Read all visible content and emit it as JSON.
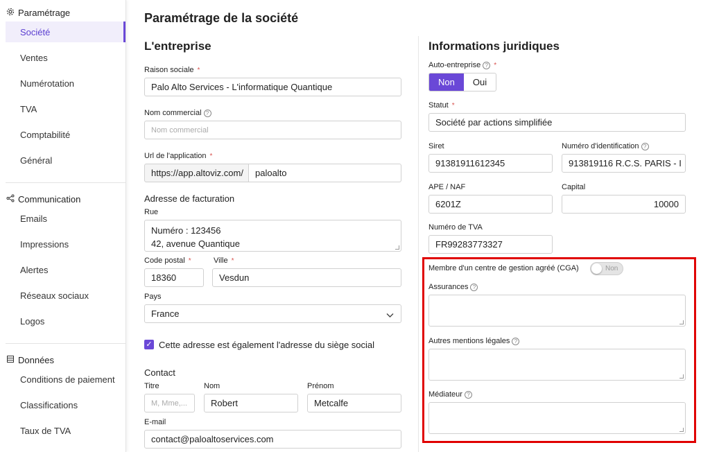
{
  "sidebar": {
    "sections": [
      {
        "title": "Paramétrage",
        "icon": "gear-icon"
      },
      {
        "title": "Communication",
        "icon": "share-icon"
      },
      {
        "title": "Données",
        "icon": "database-icon"
      }
    ],
    "parametrage_items": [
      "Société",
      "Ventes",
      "Numérotation",
      "TVA",
      "Comptabilité",
      "Général"
    ],
    "communication_items": [
      "Emails",
      "Impressions",
      "Alertes",
      "Réseaux sociaux",
      "Logos"
    ],
    "donnees_items": [
      "Conditions de paiement",
      "Classifications",
      "Taux de TVA"
    ],
    "active_color": "#6a48d7"
  },
  "page": {
    "title": "Paramétrage de la société"
  },
  "entreprise": {
    "heading": "L'entreprise",
    "raison_sociale_label": "Raison sociale",
    "raison_sociale_value": "Palo Alto Services - L'informatique Quantique",
    "nom_commercial_label": "Nom commercial",
    "nom_commercial_placeholder": "Nom commercial",
    "url_label": "Url de l'application",
    "url_prefix": "https://app.altoviz.com/",
    "url_value": "paloalto",
    "adresse_heading": "Adresse de facturation",
    "rue_label": "Rue",
    "rue_line1": "Numéro : 123456",
    "rue_line2": "42, avenue Quantique",
    "code_postal_label": "Code postal",
    "code_postal_value": "18360",
    "ville_label": "Ville",
    "ville_value": "Vesdun",
    "pays_label": "Pays",
    "pays_value": "France",
    "siege_checkbox_label": "Cette adresse est également l'adresse du siège social",
    "contact_heading": "Contact",
    "titre_label": "Titre",
    "titre_placeholder": "M, Mme,...",
    "nom_label": "Nom",
    "nom_value": "Robert",
    "prenom_label": "Prénom",
    "prenom_value": "Metcalfe",
    "email_label": "E-mail",
    "email_value": "contact@paloaltoservices.com"
  },
  "juridique": {
    "heading": "Informations juridiques",
    "auto_label": "Auto-entreprise",
    "auto_options": [
      "Non",
      "Oui"
    ],
    "statut_label": "Statut",
    "statut_value": "Société par actions simplifiée",
    "siret_label": "Siret",
    "siret_value": "91381911612345",
    "num_id_label": "Numéro d'identification",
    "num_id_value": "913819116  R.C.S. PARIS - I",
    "ape_label": "APE / NAF",
    "ape_value": "6201Z",
    "capital_label": "Capital",
    "capital_value": "10000",
    "tva_label": "Numéro de TVA",
    "tva_value": "FR99283773327",
    "cga_label": "Membre d'un centre de gestion agréé (CGA)",
    "cga_toggle_text": "Non",
    "assurances_label": "Assurances",
    "mentions_label": "Autres mentions légales",
    "mediateur_label": "Médiateur"
  }
}
